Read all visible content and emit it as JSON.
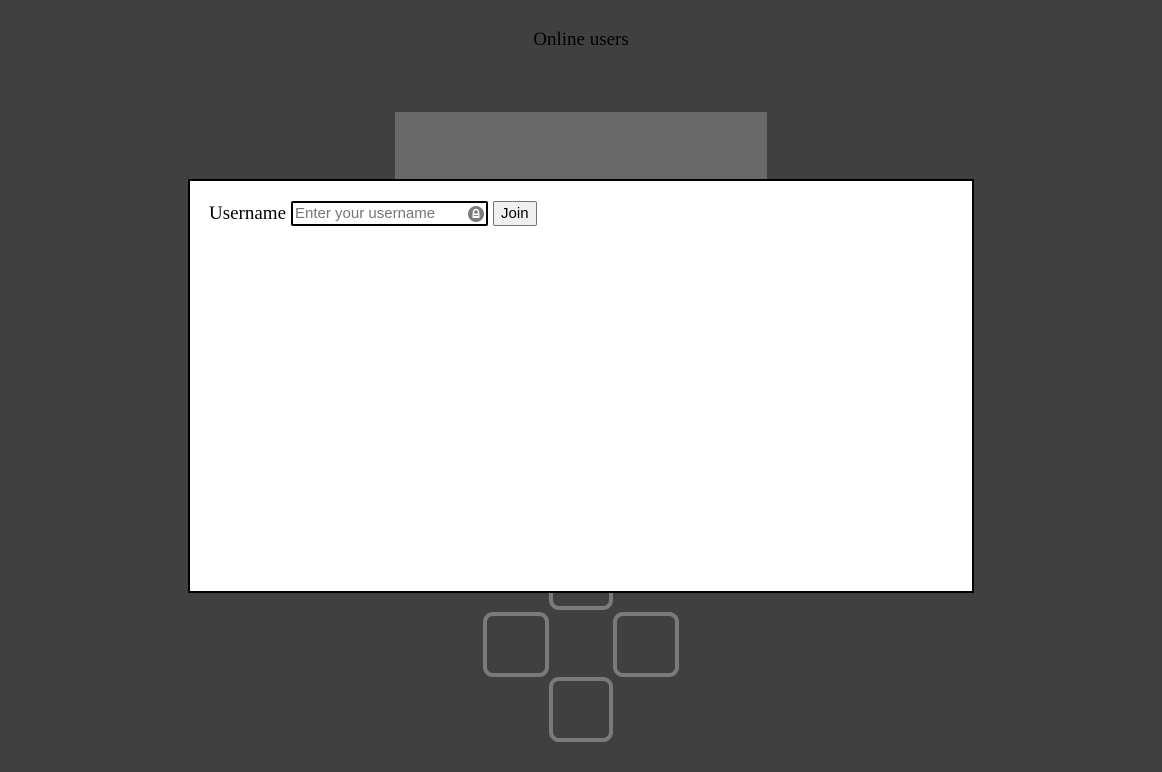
{
  "header": {
    "title": "Online users"
  },
  "login": {
    "username_label": "Username",
    "username_value": "",
    "username_placeholder": "Enter your username",
    "autofill_icon": "password-manager-icon",
    "join_label": "Join"
  },
  "controls": {
    "icons": [
      "dpad-up",
      "dpad-left",
      "dpad-right",
      "dpad-down"
    ]
  },
  "colors": {
    "background": "#404040",
    "panel": "#696969",
    "modal": "#ffffff",
    "dpad_outline": "#7a7a7a"
  }
}
